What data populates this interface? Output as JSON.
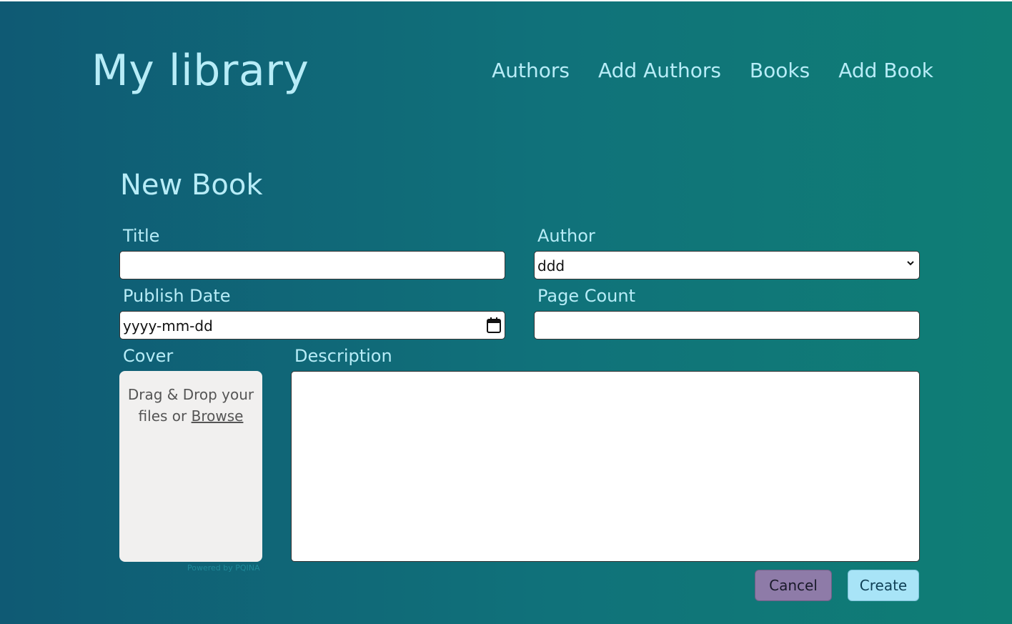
{
  "header": {
    "brand": "My library",
    "nav": [
      "Authors",
      "Add Authors",
      "Books",
      "Add Book"
    ]
  },
  "page": {
    "title": "New Book"
  },
  "form": {
    "title_label": "Title",
    "title_value": "",
    "author_label": "Author",
    "author_selected": "ddd",
    "publish_date_label": "Publish Date",
    "publish_date_placeholder": "yyyy-mm-dd",
    "page_count_label": "Page Count",
    "page_count_value": "",
    "cover_label": "Cover",
    "cover_drop_text": "Drag & Drop your files or",
    "cover_browse_link": "Browse",
    "powered_by": "Powered by PQINA",
    "description_label": "Description",
    "description_value": ""
  },
  "actions": {
    "cancel": "Cancel",
    "create": "Create"
  },
  "colors": {
    "accent_text": "#b7ecf7",
    "cancel_bg": "#8e7ba8",
    "create_bg": "#a8e4f7"
  }
}
